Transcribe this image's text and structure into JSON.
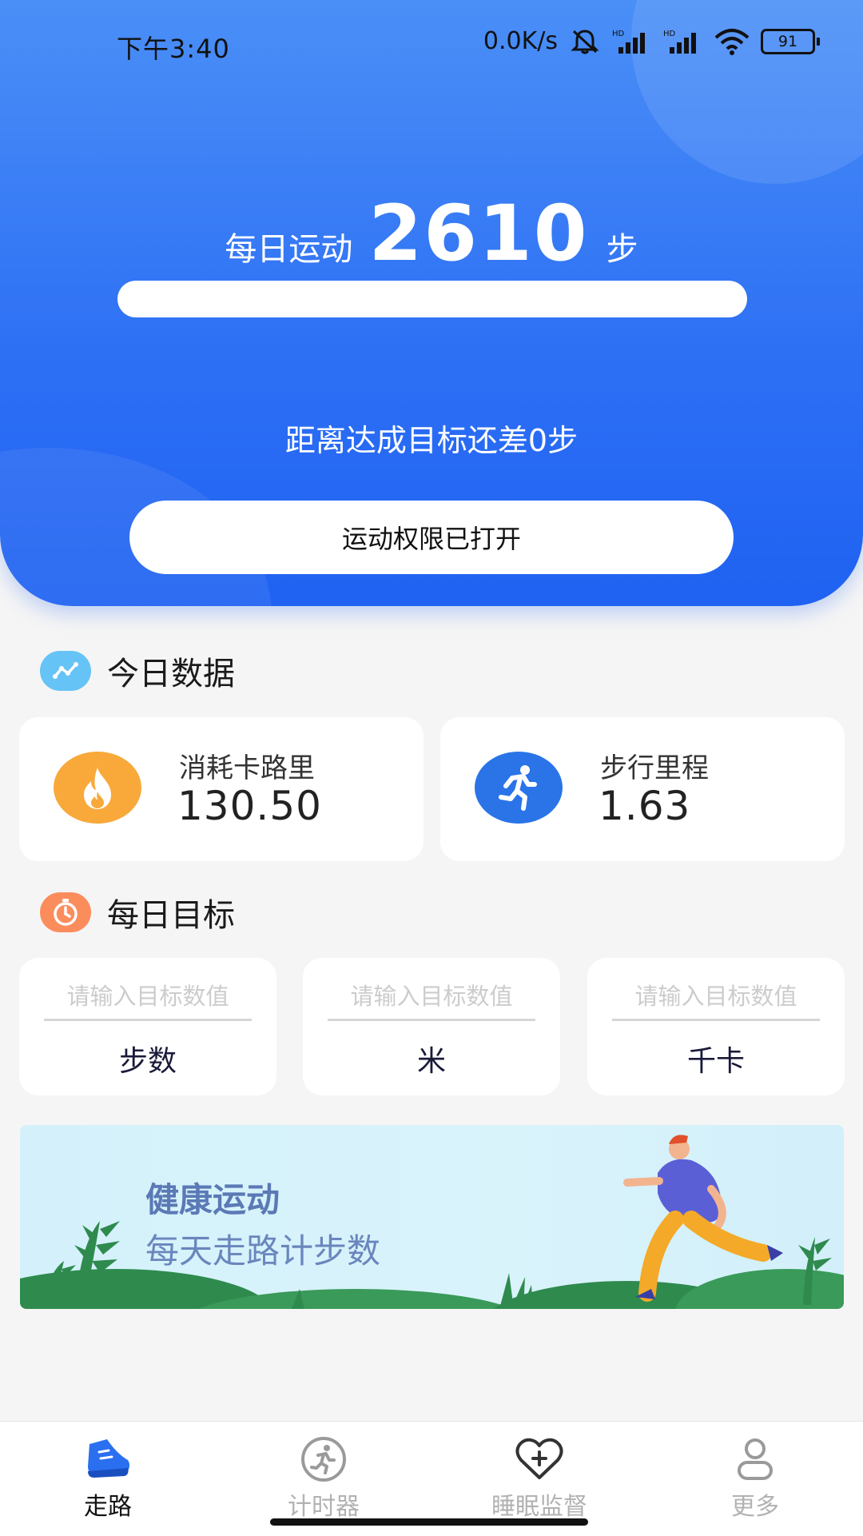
{
  "status_bar": {
    "time": "下午3:40",
    "network_speed": "0.0K/s",
    "battery": "91",
    "icons": [
      "mute-icon",
      "signal-hd-icon",
      "signal-hd-icon",
      "wifi-icon",
      "battery-icon"
    ]
  },
  "hero": {
    "steps_prefix": "每日运动",
    "steps_value": "2610",
    "steps_unit": "步",
    "progress_fraction": 1.0,
    "remaining_text": "距离达成目标还差0步",
    "permission_button": "运动权限已打开"
  },
  "today": {
    "title": "今日数据",
    "icon": "trend-chart-icon",
    "stats": [
      {
        "label": "消耗卡路里",
        "value": "130.50",
        "icon": "flame-icon",
        "color": "#f8a93a"
      },
      {
        "label": "步行里程",
        "value": "1.63",
        "icon": "runner-icon",
        "color": "#2a74e8"
      }
    ]
  },
  "goals": {
    "title": "每日目标",
    "icon": "stopwatch-icon",
    "items": [
      {
        "placeholder": "请输入目标数值",
        "value": "",
        "unit": "步数"
      },
      {
        "placeholder": "请输入目标数值",
        "value": "",
        "unit": "米"
      },
      {
        "placeholder": "请输入目标数值",
        "value": "",
        "unit": "千卡"
      }
    ]
  },
  "banner": {
    "title": "健康运动",
    "subtitle": "每天走路计步数"
  },
  "bottom_nav": [
    {
      "label": "走路",
      "icon": "shoe-icon",
      "active": true
    },
    {
      "label": "计时器",
      "icon": "runner-circle-icon",
      "active": false
    },
    {
      "label": "睡眠监督",
      "icon": "heart-plus-icon",
      "active": false
    },
    {
      "label": "更多",
      "icon": "person-icon",
      "active": false
    }
  ],
  "colors": {
    "primary": "#2d6ff4",
    "accent_orange": "#f8a93a",
    "accent_blue": "#2a74e8",
    "background": "#f5f5f5"
  }
}
